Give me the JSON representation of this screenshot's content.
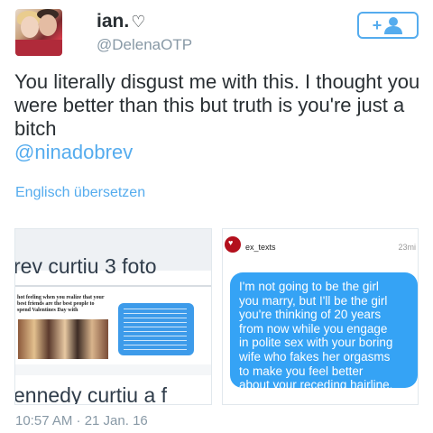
{
  "user": {
    "display_name": "ian.",
    "heart_glyph": "♡",
    "handle": "@DelenaOTP"
  },
  "follow_button": {
    "plus": "+",
    "icon": "person-icon"
  },
  "tweet": {
    "text": "You literally disgust me with this. I thought you were better than this but truth is you're just a bitch",
    "mention": "@ninadobrev",
    "translate_link": "Englisch übersetzen",
    "timestamp": "10:57 AM · 21 Jan. 16"
  },
  "media_left": {
    "headline_top": "rev curtiu 3 foto",
    "caption": "hot feeling when you realize that your best friends are the best people to spend Valentines Day with",
    "headline_bottom": "ennedy curtiu a f"
  },
  "media_right": {
    "username": "ex_texts",
    "time": "23mi",
    "message_lines": [
      "I'm not going to be the girl",
      "you marry, but I'll be the girl",
      "you're thinking of 20 years",
      "from now while you engage",
      "in polite sex with your boring",
      "wife who fakes her orgasms",
      "to make you feel better",
      "about your receding hairline."
    ]
  },
  "colors": {
    "accent": "#55acee",
    "text": "#292f33",
    "muted": "#8899a6",
    "bubble": "#35a3f5"
  }
}
